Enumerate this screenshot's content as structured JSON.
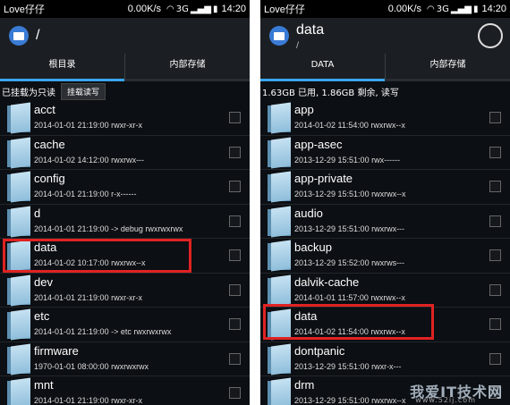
{
  "status_left": {
    "carrier": "Love仔仔",
    "speed": "0.00K/s",
    "network": "3G",
    "time": "14:20"
  },
  "status_right": {
    "carrier": "Love仔仔",
    "speed": "0.00K/s",
    "network": "3G",
    "time": "14:20"
  },
  "left": {
    "title": "/",
    "tabs": [
      {
        "label": "根目录"
      },
      {
        "label": "内部存储"
      }
    ],
    "mount_info": "已挂载为只读",
    "rw_button": "挂载读写",
    "items": [
      {
        "name": "acct",
        "meta": "2014-01-01 21:19:00   rwxr-xr-x"
      },
      {
        "name": "cache",
        "meta": "2014-01-02 14:12:00   rwxrwx---"
      },
      {
        "name": "config",
        "meta": "2014-01-01 21:19:00   r-x------"
      },
      {
        "name": "d",
        "meta": "2014-01-01 21:19:00  -> debug  rwxrwxrwx"
      },
      {
        "name": "data",
        "meta": "2014-01-02 10:17:00   rwxrwx--x"
      },
      {
        "name": "dev",
        "meta": "2014-01-01 21:19:00   rwxr-xr-x"
      },
      {
        "name": "etc",
        "meta": "2014-01-01 21:19:00  -> etc  rwxrwxrwx"
      },
      {
        "name": "firmware",
        "meta": "1970-01-01 08:00:00   rwxrwxrwx"
      },
      {
        "name": "mnt",
        "meta": "2014-01-01 21:19:00   rwxr-xr-x"
      }
    ]
  },
  "right": {
    "title": "data",
    "subtitle": "/",
    "tabs": [
      {
        "label": "DATA"
      },
      {
        "label": "内部存储"
      }
    ],
    "storage_info": "1.63GB 已用, 1.86GB 剩余, 读写",
    "items": [
      {
        "name": "app",
        "meta": "2014-01-02 11:54:00   rwxrwx--x"
      },
      {
        "name": "app-asec",
        "meta": "2013-12-29 15:51:00   rwx------"
      },
      {
        "name": "app-private",
        "meta": "2013-12-29 15:51:00   rwxrwx--x"
      },
      {
        "name": "audio",
        "meta": "2013-12-29 15:51:00   rwxrwx---"
      },
      {
        "name": "backup",
        "meta": "2013-12-29 15:52:00   rwxrws---"
      },
      {
        "name": "dalvik-cache",
        "meta": "2014-01-01 11:57:00   rwxrwx--x"
      },
      {
        "name": "data",
        "meta": "2014-01-02 11:54:00   rwxrwx--x"
      },
      {
        "name": "dontpanic",
        "meta": "2013-12-29 15:51:00   rwxr-x---"
      },
      {
        "name": "drm",
        "meta": "2013-12-29 15:51:00   rwxrwx--x"
      }
    ]
  },
  "watermark": {
    "text": "我爱IT技术网",
    "site": "www.52ij.com"
  },
  "colors": {
    "highlight": "#e02222",
    "accent": "#3ba4f0",
    "background": "#0c0f13"
  }
}
